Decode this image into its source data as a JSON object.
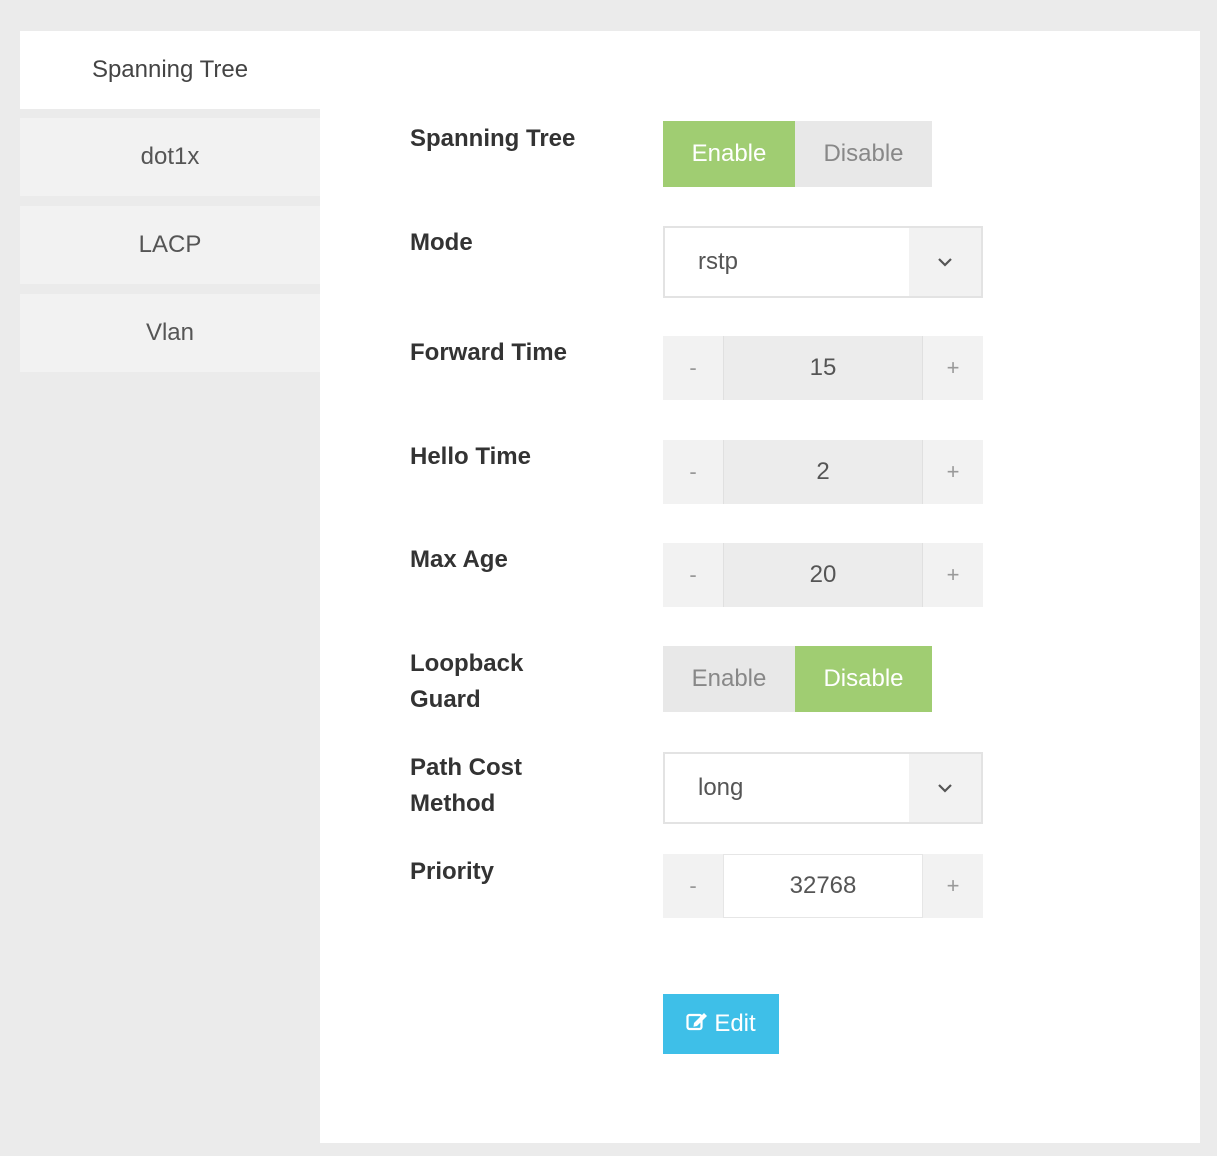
{
  "tabs": [
    {
      "label": "Spanning Tree",
      "active": true
    },
    {
      "label": "dot1x",
      "active": false
    },
    {
      "label": "LACP",
      "active": false
    },
    {
      "label": "Vlan",
      "active": false
    }
  ],
  "form": {
    "spanning_tree": {
      "label": "Spanning Tree",
      "enable": "Enable",
      "disable": "Disable",
      "selected": "Enable"
    },
    "mode": {
      "label": "Mode",
      "value": "rstp"
    },
    "forward_time": {
      "label": "Forward Time",
      "value": "15",
      "minus": "-",
      "plus": "+"
    },
    "hello_time": {
      "label": "Hello Time",
      "value": "2",
      "minus": "-",
      "plus": "+"
    },
    "max_age": {
      "label": "Max Age",
      "value": "20",
      "minus": "-",
      "plus": "+"
    },
    "loopback_guard": {
      "label_line1": "Loopback",
      "label_line2": "Guard",
      "enable": "Enable",
      "disable": "Disable",
      "selected": "Disable"
    },
    "path_cost_method": {
      "label_line1": "Path Cost",
      "label_line2": "Method",
      "value": "long"
    },
    "priority": {
      "label": "Priority",
      "value": "32768",
      "minus": "-",
      "plus": "+"
    }
  },
  "actions": {
    "edit_label": "Edit",
    "edit_icon": "edit-icon"
  },
  "colors": {
    "active_green": "#a0cd72",
    "edit_blue": "#3ebfe8"
  }
}
